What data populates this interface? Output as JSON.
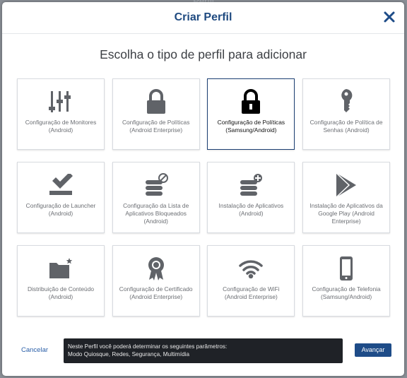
{
  "background": {
    "peek_text": "Perfil"
  },
  "modal": {
    "title": "Criar Perfil",
    "subtitle": "Escolha o tipo de perfil para adicionar"
  },
  "colors": {
    "accent": "#1e4c88",
    "title": "#1f4a80",
    "icon": "#606368",
    "selected_icon": "#000000"
  },
  "cards": [
    {
      "icon": "sliders-icon",
      "line1": "Configuração de Monitores",
      "line2": "(Android)",
      "selected": false
    },
    {
      "icon": "lock-icon",
      "line1": "Configuração de Políticas",
      "line2": "(Android Enterprise)",
      "selected": false
    },
    {
      "icon": "lock-icon",
      "line1": "Configuração de Políticas",
      "line2": "(Samsung/Android)",
      "selected": true
    },
    {
      "icon": "key-icon",
      "line1": "Configuração de Política de",
      "line2": "Senhas (Android)",
      "selected": false
    },
    {
      "icon": "launcher-icon",
      "line1": "Configuração de Launcher",
      "line2": "(Android)",
      "selected": false
    },
    {
      "icon": "blocked-apps-icon",
      "line1": "Configuração da Lista de",
      "line2": "Aplicativos Bloqueados",
      "line3": "(Android)",
      "selected": false
    },
    {
      "icon": "install-apps-icon",
      "line1": "Instalação de Aplicativos",
      "line2": "(Android)",
      "selected": false
    },
    {
      "icon": "play-store-icon",
      "line1": "Instalação de Aplicativos da",
      "line2": "Google Play (Android",
      "line3": "Enterprise)",
      "selected": false
    },
    {
      "icon": "folder-icon",
      "line1": "Distribuição de Conteúdo",
      "line2": "(Android)",
      "selected": false
    },
    {
      "icon": "certificate-icon",
      "line1": "Configuração de Certificado",
      "line2": "(Android Enterprise)",
      "selected": false
    },
    {
      "icon": "wifi-icon",
      "line1": "Configuração de WiFi",
      "line2": "(Android Enterprise)",
      "selected": false
    },
    {
      "icon": "phone-icon",
      "line1": "Configuração de Telefonia",
      "line2": "(Samsung/Android)",
      "selected": false
    }
  ],
  "footer": {
    "cancel_label": "Cancelar",
    "info_line1": "Neste Perfil você poderá determinar os seguintes parâmetros:",
    "info_line2": "Modo Quiosque, Redes, Segurança, Multimídia",
    "next_label": "Avançar"
  }
}
